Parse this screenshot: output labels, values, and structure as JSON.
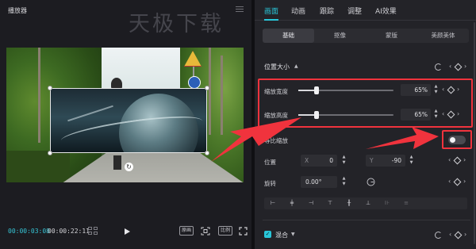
{
  "player": {
    "title": "播放器",
    "watermark": "天极下载",
    "time_current": "00:00:03:08",
    "time_total": "00:00:22:11",
    "btn_proof": "原画",
    "btn_ratio": "比例"
  },
  "inspector": {
    "tabs": [
      "画面",
      "动画",
      "跟踪",
      "调整",
      "AI效果"
    ],
    "active_tab": "画面",
    "subtabs": [
      "基础",
      "抠像",
      "蒙版",
      "美颜美体"
    ],
    "active_subtab": "基础",
    "section_position_size": "位置大小",
    "scale_width_label": "缩放宽度",
    "scale_width_value": "65%",
    "scale_width_fraction": 0.65,
    "scale_height_label": "缩放高度",
    "scale_height_value": "65%",
    "scale_height_fraction": 0.65,
    "proportional_label": "等比缩放",
    "proportional_on": false,
    "position_label": "位置",
    "pos_x_axis": "X",
    "pos_x_value": "0",
    "pos_y_axis": "Y",
    "pos_y_value": "-90",
    "rotation_label": "旋转",
    "rotation_value": "0.00°",
    "section_blend": "混合",
    "blend_checked": true
  },
  "colors": {
    "accent": "#29c6d9",
    "highlight": "#f0333d",
    "panel": "#232328"
  },
  "icons": [
    "menu-icon",
    "grid-icon",
    "play-icon",
    "focus-icon",
    "fullscreen-icon",
    "reset-icon",
    "keyframe-icon",
    "chevron-left-icon",
    "chevron-right-icon",
    "rotate-handle-icon",
    "align-left-icon",
    "align-center-h-icon",
    "align-right-icon",
    "align-top-icon",
    "align-center-v-icon",
    "align-bottom-icon",
    "distribute-h-icon",
    "distribute-v-icon"
  ]
}
